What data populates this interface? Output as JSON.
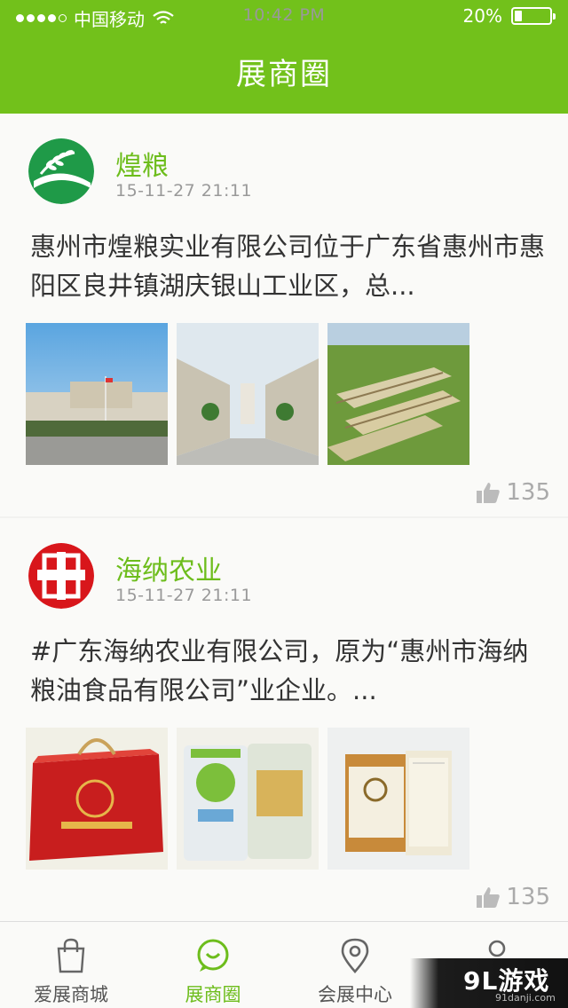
{
  "status": {
    "carrier": "中国移动",
    "time": "10:42 PM",
    "battery": "20%",
    "battery_level": 0.2
  },
  "nav": {
    "title": "展商圈"
  },
  "posts": [
    {
      "name": "煌粮",
      "time": "15-11-27 21:11",
      "text": "惠州市煌粮实业有限公司位于广东省惠州市惠阳区良井镇湖庆银山工业区，总...",
      "likes": "135",
      "avatar_icon": "grain-logo-icon",
      "images": [
        "factory-gate-photo",
        "factory-courtyard-photo",
        "factory-aerial-photo"
      ]
    },
    {
      "name": "海纳农业",
      "time": "15-11-27 21:11",
      "text": "#广东海纳农业有限公司，原为“惠州市海纳粮油食品有限公司”业企业。...",
      "likes": "135",
      "avatar_icon": "haina-logo-icon",
      "images": [
        "red-gift-box-photo",
        "rice-bag-photo",
        "rice-box-photo"
      ]
    }
  ],
  "tabs": [
    {
      "label": "爱展商城",
      "icon": "shopping-bag-icon"
    },
    {
      "label": "展商圈",
      "icon": "chat-bubble-icon"
    },
    {
      "label": "会展中心",
      "icon": "location-pin-icon"
    },
    {
      "label": "",
      "icon": "user-icon"
    }
  ],
  "watermark": {
    "text": "9L游戏",
    "sub": "91danji.com"
  },
  "colors": {
    "accent": "#72c11b",
    "accent_text": "#6dbd1c"
  }
}
